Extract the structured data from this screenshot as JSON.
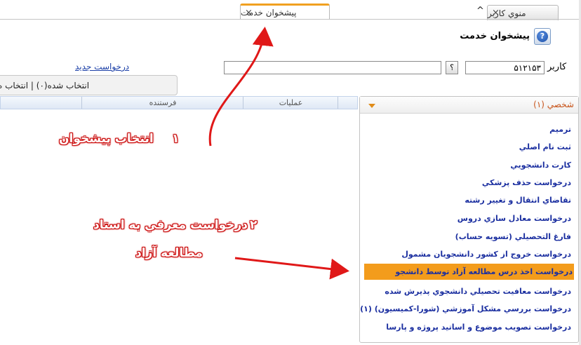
{
  "tabs": [
    {
      "label": "منوي کاربر",
      "close": "×",
      "active": false
    },
    {
      "label": "پيشخوان خدمت",
      "close": "×",
      "active": true
    }
  ],
  "expand_glyph": "^",
  "header": {
    "title": "پيشخوان خدمت",
    "help_glyph": "?"
  },
  "user_row": {
    "label": "کاربر",
    "user_value": "۵۱۲۱۵۳",
    "lookup_glyph": "؟",
    "search_value": ""
  },
  "new_request_link": "درخواست جديد",
  "selection_bar": "انتخاب شده(۰) | انتخاب ه",
  "grid": {
    "columns": [
      "عمليات",
      "فرستنده"
    ]
  },
  "panel": {
    "title": "شخصي (۱)",
    "items": [
      "ترميم",
      "ثبت نام اصلي",
      "کارت دانشجويي",
      "درخواست حذف پزشکي",
      "تقاضاي انتقال و تغيير رشته",
      "درخواست معادل سازي دروس",
      "فارغ التحصيلي (تسويه حساب)",
      "درخواست خروج از کشور دانشجويان مشمول",
      "درخواست اخذ درس مطالعه آزاد توسط دانشجو",
      "درخواست معافيت تحصيلي دانشجوي پذيرش شده",
      "درخواست بررسي مشکل آموزشي (شورا-کميسيون) (۱)",
      "درخواست تصويب موضوع و اساتيد پروژه و پارسا"
    ],
    "highlighted_index": 8
  },
  "annotations": {
    "step1_num": "۱",
    "step1_text": "انتخاب پيشخوان",
    "step2_num": "۲",
    "step2_line1": "درخواست معرفي به استاد",
    "step2_line2": "مطالعه آزاد"
  },
  "colors": {
    "accent": "#f39c1c",
    "link": "#1b3fa7",
    "annotation": "#d41414"
  }
}
